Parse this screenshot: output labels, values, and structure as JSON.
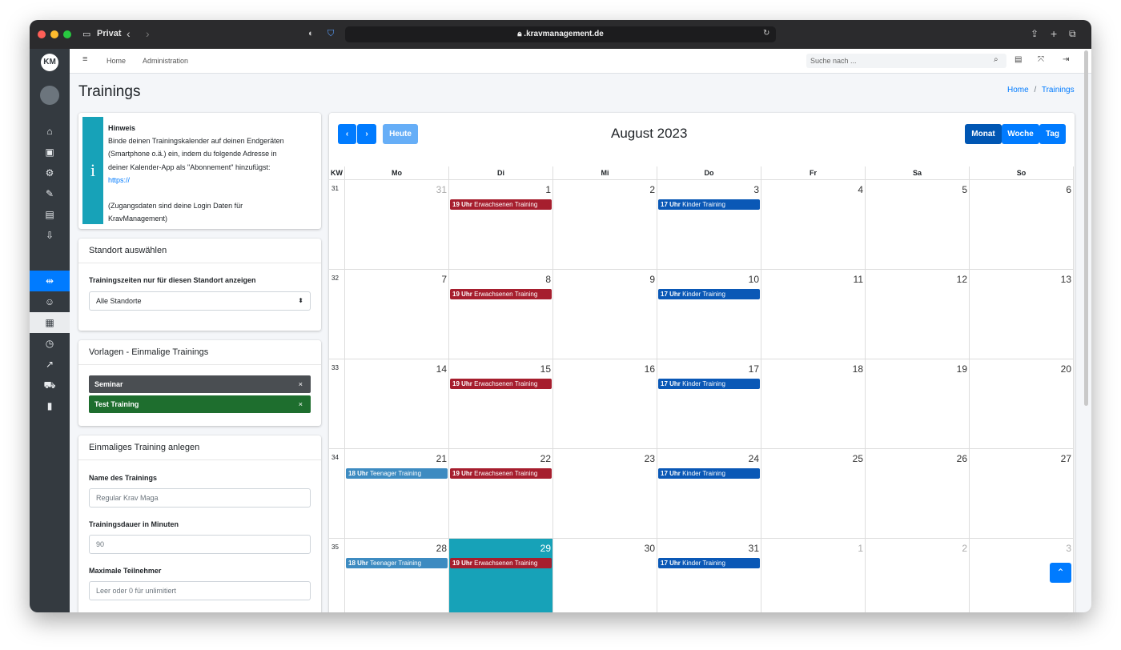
{
  "browser": {
    "mode_label": "Privat",
    "url": ".kravmanagement.de",
    "back": "‹",
    "forward": "›"
  },
  "colors": {
    "primary": "#007bff",
    "info": "#17a2b8",
    "dark": "#343a40",
    "erwachsenen": "#a61e2e",
    "kinder": "#0a58b6",
    "teenager": "#3d8bc1",
    "seminar": "#4a4e52",
    "test_training": "#1e6e2e"
  },
  "topnav": {
    "home": "Home",
    "administration": "Administration",
    "search_placeholder": "Suche nach ..."
  },
  "page": {
    "title": "Trainings",
    "breadcrumb_home": "Home",
    "breadcrumb_sep": "/",
    "breadcrumb_current": "Trainings"
  },
  "hint": {
    "title": "Hinweis",
    "line1": "Binde deinen Trainingskalender auf deinen Endgeräten",
    "line2": "(Smartphone o.ä.) ein, indem du folgende Adresse in",
    "line3": "deiner Kalender-App als \"Abonnement\" hinzufügst:",
    "link": "https://",
    "note1": "(Zugangsdaten sind deine Login Daten für",
    "note2": "KravManagement)"
  },
  "standort": {
    "header": "Standort auswählen",
    "label": "Trainingszeiten nur für diesen Standort anzeigen",
    "selected": "Alle Standorte"
  },
  "vorlagen": {
    "header": "Vorlagen - Einmalige Trainings",
    "items": [
      {
        "label": "Seminar",
        "remove": "×"
      },
      {
        "label": "Test Training",
        "remove": "×"
      }
    ]
  },
  "anlegen": {
    "header": "Einmaliges Training anlegen",
    "name_label": "Name des Trainings",
    "name_placeholder": "Regular Krav Maga",
    "dauer_label": "Trainingsdauer in Minuten",
    "dauer_value": "90",
    "max_label": "Maximale Teilnehmer",
    "max_placeholder": "Leer oder 0 für unlimitiert"
  },
  "calendar": {
    "title": "August 2023",
    "today_label": "Heute",
    "views": [
      "Monat",
      "Woche",
      "Tag"
    ],
    "kw_header": "KW",
    "weekdays": [
      "Mo",
      "Di",
      "Mi",
      "Do",
      "Fr",
      "Sa",
      "So"
    ],
    "weeks": [
      {
        "kw": "31",
        "days": [
          "31",
          "1",
          "2",
          "3",
          "4",
          "5",
          "6"
        ]
      },
      {
        "kw": "32",
        "days": [
          "7",
          "8",
          "9",
          "10",
          "11",
          "12",
          "13"
        ]
      },
      {
        "kw": "33",
        "days": [
          "14",
          "15",
          "16",
          "17",
          "18",
          "19",
          "20"
        ]
      },
      {
        "kw": "34",
        "days": [
          "21",
          "22",
          "23",
          "24",
          "25",
          "26",
          "27"
        ]
      },
      {
        "kw": "35",
        "days": [
          "28",
          "29",
          "30",
          "31",
          "1",
          "2",
          "3"
        ]
      }
    ],
    "events": {
      "erwachsenen": {
        "time": "19 Uhr",
        "name": "Erwachsenen Training"
      },
      "kinder": {
        "time": "17 Uhr",
        "name": "Kinder Training"
      },
      "teenager": {
        "time": "18 Uhr",
        "name": "Teenager Training"
      }
    }
  }
}
